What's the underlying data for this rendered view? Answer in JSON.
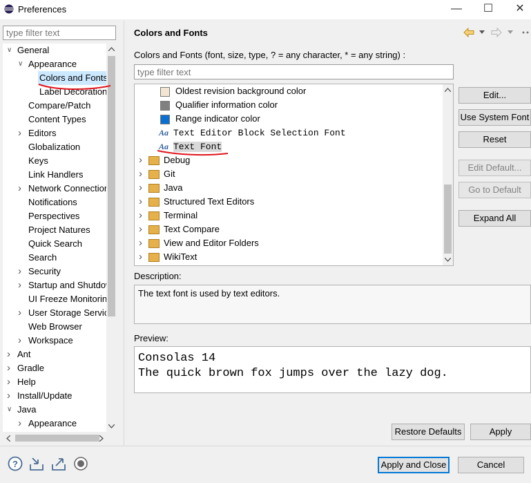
{
  "window": {
    "title": "Preferences",
    "minimize": "—",
    "maximize": "☐",
    "close": "✕"
  },
  "left": {
    "filter_placeholder": "type filter text",
    "tree": [
      {
        "label": "General",
        "level": 0,
        "twisty": "open"
      },
      {
        "label": "Appearance",
        "level": 1,
        "twisty": "open"
      },
      {
        "label": "Colors and Fonts",
        "level": 2,
        "twisty": "none",
        "selected": true
      },
      {
        "label": "Label Decorations",
        "level": 2,
        "twisty": "none"
      },
      {
        "label": "Compare/Patch",
        "level": 1,
        "twisty": "none"
      },
      {
        "label": "Content Types",
        "level": 1,
        "twisty": "none"
      },
      {
        "label": "Editors",
        "level": 1,
        "twisty": "closed"
      },
      {
        "label": "Globalization",
        "level": 1,
        "twisty": "none"
      },
      {
        "label": "Keys",
        "level": 1,
        "twisty": "none"
      },
      {
        "label": "Link Handlers",
        "level": 1,
        "twisty": "none"
      },
      {
        "label": "Network Connections",
        "level": 1,
        "twisty": "closed"
      },
      {
        "label": "Notifications",
        "level": 1,
        "twisty": "none"
      },
      {
        "label": "Perspectives",
        "level": 1,
        "twisty": "none"
      },
      {
        "label": "Project Natures",
        "level": 1,
        "twisty": "none"
      },
      {
        "label": "Quick Search",
        "level": 1,
        "twisty": "none"
      },
      {
        "label": "Search",
        "level": 1,
        "twisty": "none"
      },
      {
        "label": "Security",
        "level": 1,
        "twisty": "closed"
      },
      {
        "label": "Startup and Shutdown",
        "level": 1,
        "twisty": "closed"
      },
      {
        "label": "UI Freeze Monitoring",
        "level": 1,
        "twisty": "none"
      },
      {
        "label": "User Storage Service",
        "level": 1,
        "twisty": "closed"
      },
      {
        "label": "Web Browser",
        "level": 1,
        "twisty": "none"
      },
      {
        "label": "Workspace",
        "level": 1,
        "twisty": "closed"
      },
      {
        "label": "Ant",
        "level": 0,
        "twisty": "closed"
      },
      {
        "label": "Gradle",
        "level": 0,
        "twisty": "closed"
      },
      {
        "label": "Help",
        "level": 0,
        "twisty": "closed"
      },
      {
        "label": "Install/Update",
        "level": 0,
        "twisty": "closed"
      },
      {
        "label": "Java",
        "level": 0,
        "twisty": "open"
      },
      {
        "label": "Appearance",
        "level": 1,
        "twisty": "closed"
      }
    ]
  },
  "right": {
    "page_title": "Colors and Fonts",
    "intro": "Colors and Fonts (font, size, type, ? = any character, * = any string) :",
    "filter_placeholder": "type filter text",
    "items": [
      {
        "kind": "color",
        "label": "Oldest revision background color",
        "color": "#f3e5d1"
      },
      {
        "kind": "color",
        "label": "Qualifier information color",
        "color": "#808080"
      },
      {
        "kind": "color",
        "label": "Range indicator color",
        "color": "#0a6fd1"
      },
      {
        "kind": "font",
        "label": "Text Editor Block Selection Font",
        "icon": "Aa"
      },
      {
        "kind": "font",
        "label": "Text Font",
        "icon": "Aa",
        "selected": true
      },
      {
        "kind": "folder",
        "label": "Debug"
      },
      {
        "kind": "folder",
        "label": "Git"
      },
      {
        "kind": "folder",
        "label": "Java"
      },
      {
        "kind": "folder",
        "label": "Structured Text Editors"
      },
      {
        "kind": "folder",
        "label": "Terminal"
      },
      {
        "kind": "folder",
        "label": "Text Compare"
      },
      {
        "kind": "folder",
        "label": "View and Editor Folders"
      },
      {
        "kind": "folder",
        "label": "WikiText"
      }
    ],
    "buttons": {
      "edit": "Edit...",
      "use_system_font": "Use System Font",
      "reset": "Reset",
      "edit_default": "Edit Default...",
      "go_to_default": "Go to Default",
      "expand_all": "Expand All"
    },
    "description_label": "Description:",
    "description": "The text font is used by text editors.",
    "preview_label": "Preview:",
    "preview_lines": [
      "Consolas 14",
      "The quick brown fox jumps over the lazy dog."
    ],
    "restore_defaults": "Restore Defaults",
    "apply": "Apply"
  },
  "footer": {
    "apply_and_close": "Apply and Close",
    "cancel": "Cancel",
    "icons": [
      "help-icon",
      "import-icon",
      "export-icon",
      "record-icon"
    ]
  },
  "colors": {
    "accent": "#0078d7",
    "annotation": "#e0141e"
  }
}
